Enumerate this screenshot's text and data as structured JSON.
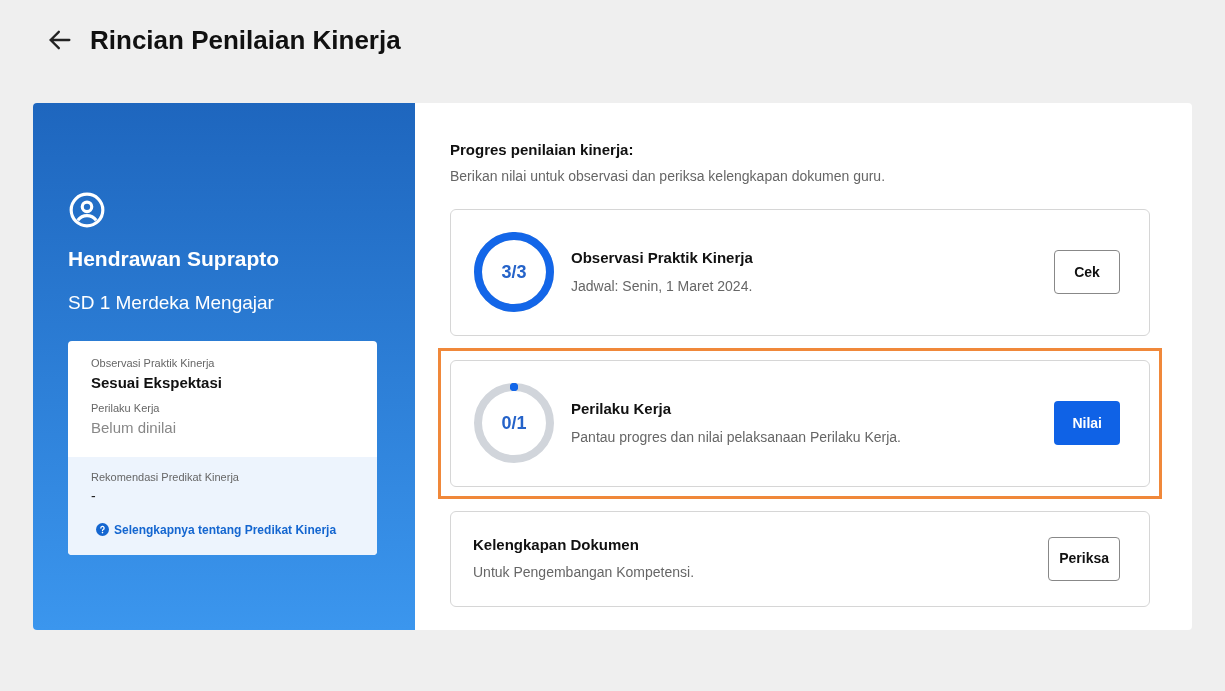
{
  "header": {
    "title": "Rincian Penilaian Kinerja"
  },
  "profile": {
    "name": "Hendrawan Suprapto",
    "school": "SD 1 Merdeka Mengajar",
    "summary": [
      {
        "label": "Observasi Praktik Kinerja",
        "value": "Sesuai Ekspektasi",
        "rated": true
      },
      {
        "label": "Perilaku Kerja",
        "value": "Belum dinilai",
        "rated": false
      }
    ],
    "recommendation": {
      "label": "Rekomendasi Predikat Kinerja",
      "value": "-"
    },
    "link": "Selengkapnya tentang Predikat Kinerja"
  },
  "progress": {
    "title": "Progres penilaian kinerja:",
    "subtitle": "Berikan nilai untuk observasi dan periksa kelengkapan dokumen guru.",
    "items": [
      {
        "kind": "ring",
        "count": "3/3",
        "level": 1,
        "title": "Observasi Praktik Kinerja",
        "description": "Jadwal: Senin, 1 Maret 2024.",
        "button": "Cek",
        "primary": false,
        "highlighted": false
      },
      {
        "kind": "ring",
        "count": "0/1",
        "level": 0,
        "title": "Perilaku Kerja",
        "description": "Pantau progres dan nilai pelaksanaan Perilaku Kerja.",
        "button": "Nilai",
        "primary": true,
        "highlighted": true
      },
      {
        "kind": "plain",
        "title": "Kelengkapan Dokumen",
        "description": "Untuk Pengembangan Kompetensi.",
        "button": "Periksa",
        "primary": false,
        "highlighted": false
      }
    ]
  }
}
